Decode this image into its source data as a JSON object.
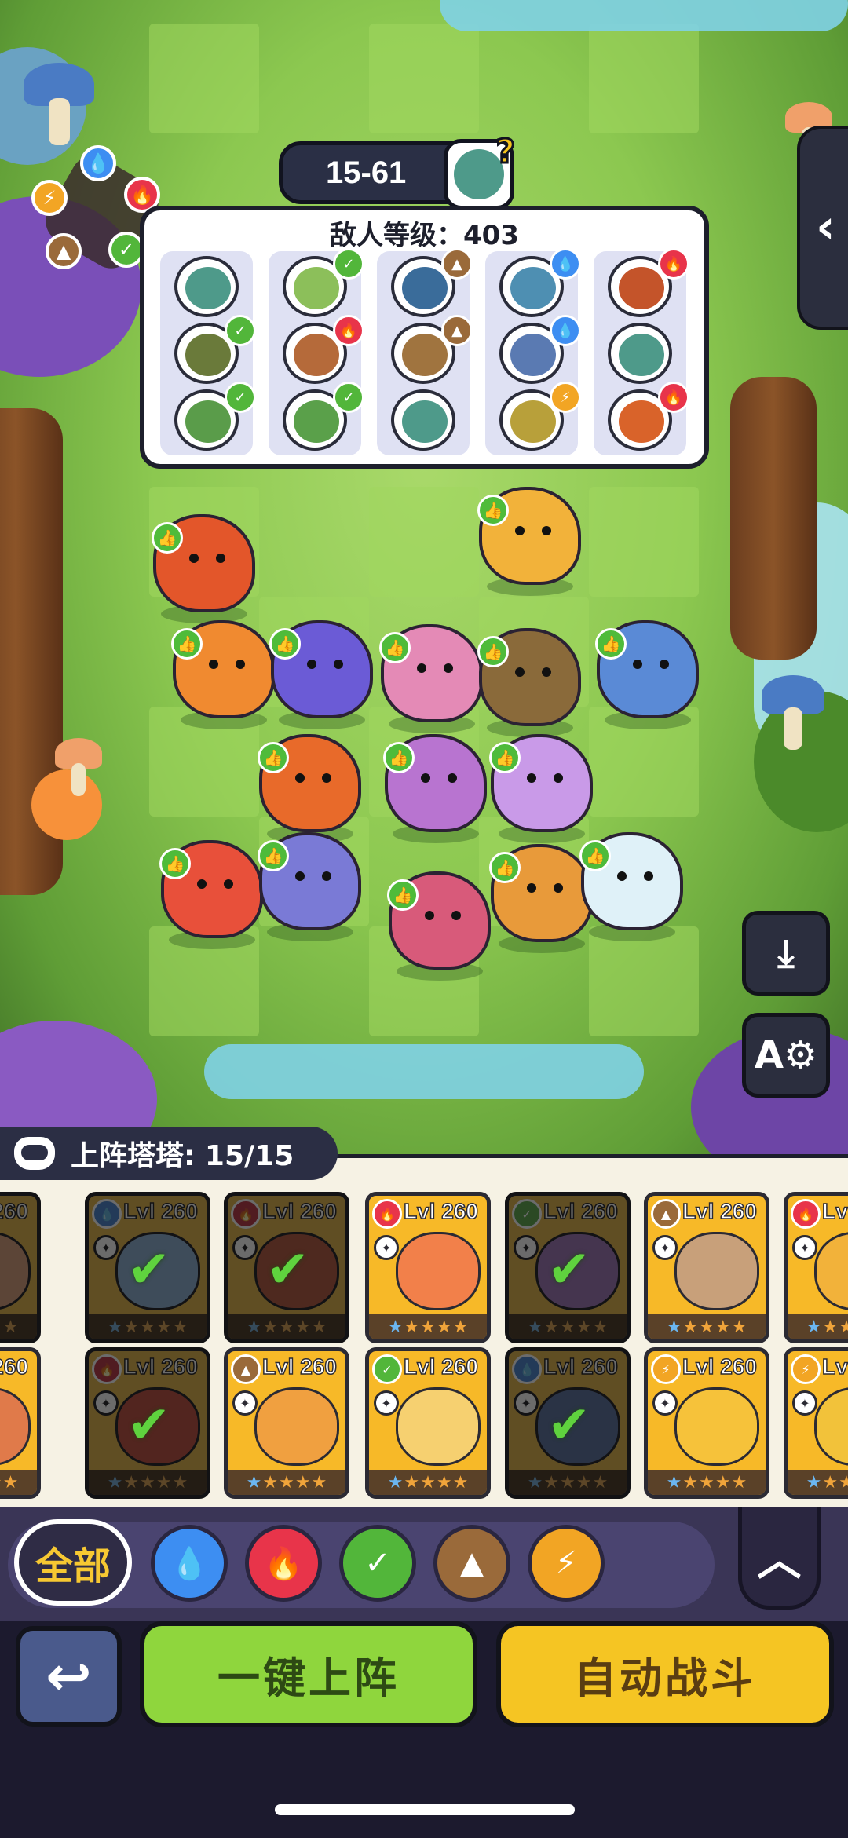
{
  "stage": {
    "number": "15-61",
    "boss_icon": "zombie-question-icon"
  },
  "element_wheel": [
    "water",
    "fire",
    "grass",
    "earth",
    "light"
  ],
  "enemy": {
    "level_text": "敌人等级：403",
    "columns": [
      {
        "mobs": [
          {
            "color": "#4e9a8a",
            "badge": ""
          },
          {
            "color": "#6a7a3a",
            "badge": "grass"
          },
          {
            "color": "#5a9c4a",
            "badge": "grass"
          }
        ]
      },
      {
        "mobs": [
          {
            "color": "#8cbf5a",
            "badge": "grass"
          },
          {
            "color": "#b56a3a",
            "badge": "fire"
          },
          {
            "color": "#5aa04a",
            "badge": "grass"
          }
        ]
      },
      {
        "mobs": [
          {
            "color": "#3a6c9a",
            "badge": "earth"
          },
          {
            "color": "#a0743f",
            "badge": "earth"
          },
          {
            "color": "#4e9a8a",
            "badge": ""
          }
        ]
      },
      {
        "mobs": [
          {
            "color": "#4e8fb2",
            "badge": "water"
          },
          {
            "color": "#5a7ab2",
            "badge": "water"
          },
          {
            "color": "#b8a03a",
            "badge": "light"
          }
        ]
      },
      {
        "mobs": [
          {
            "color": "#c4542a",
            "badge": "fire"
          },
          {
            "color": "#4e9a8a",
            "badge": ""
          },
          {
            "color": "#d9632a",
            "badge": "fire"
          }
        ]
      }
    ]
  },
  "colors": {
    "water": "#3d8ef2",
    "fire": "#e8344a",
    "grass": "#52b63a",
    "earth": "#9a6a3a",
    "light": "#f2a524"
  },
  "roster": {
    "label": "上阵塔塔: 15/15",
    "level_text": "Lvl 260"
  },
  "filters": {
    "all_label": "全部",
    "elements": [
      "water",
      "fire",
      "grass",
      "earth",
      "light"
    ]
  },
  "actions": {
    "deploy_label": "一键上阵",
    "auto_label": "自动战斗"
  },
  "side_buttons": [
    "download-icon",
    "auto-settings-icon"
  ]
}
